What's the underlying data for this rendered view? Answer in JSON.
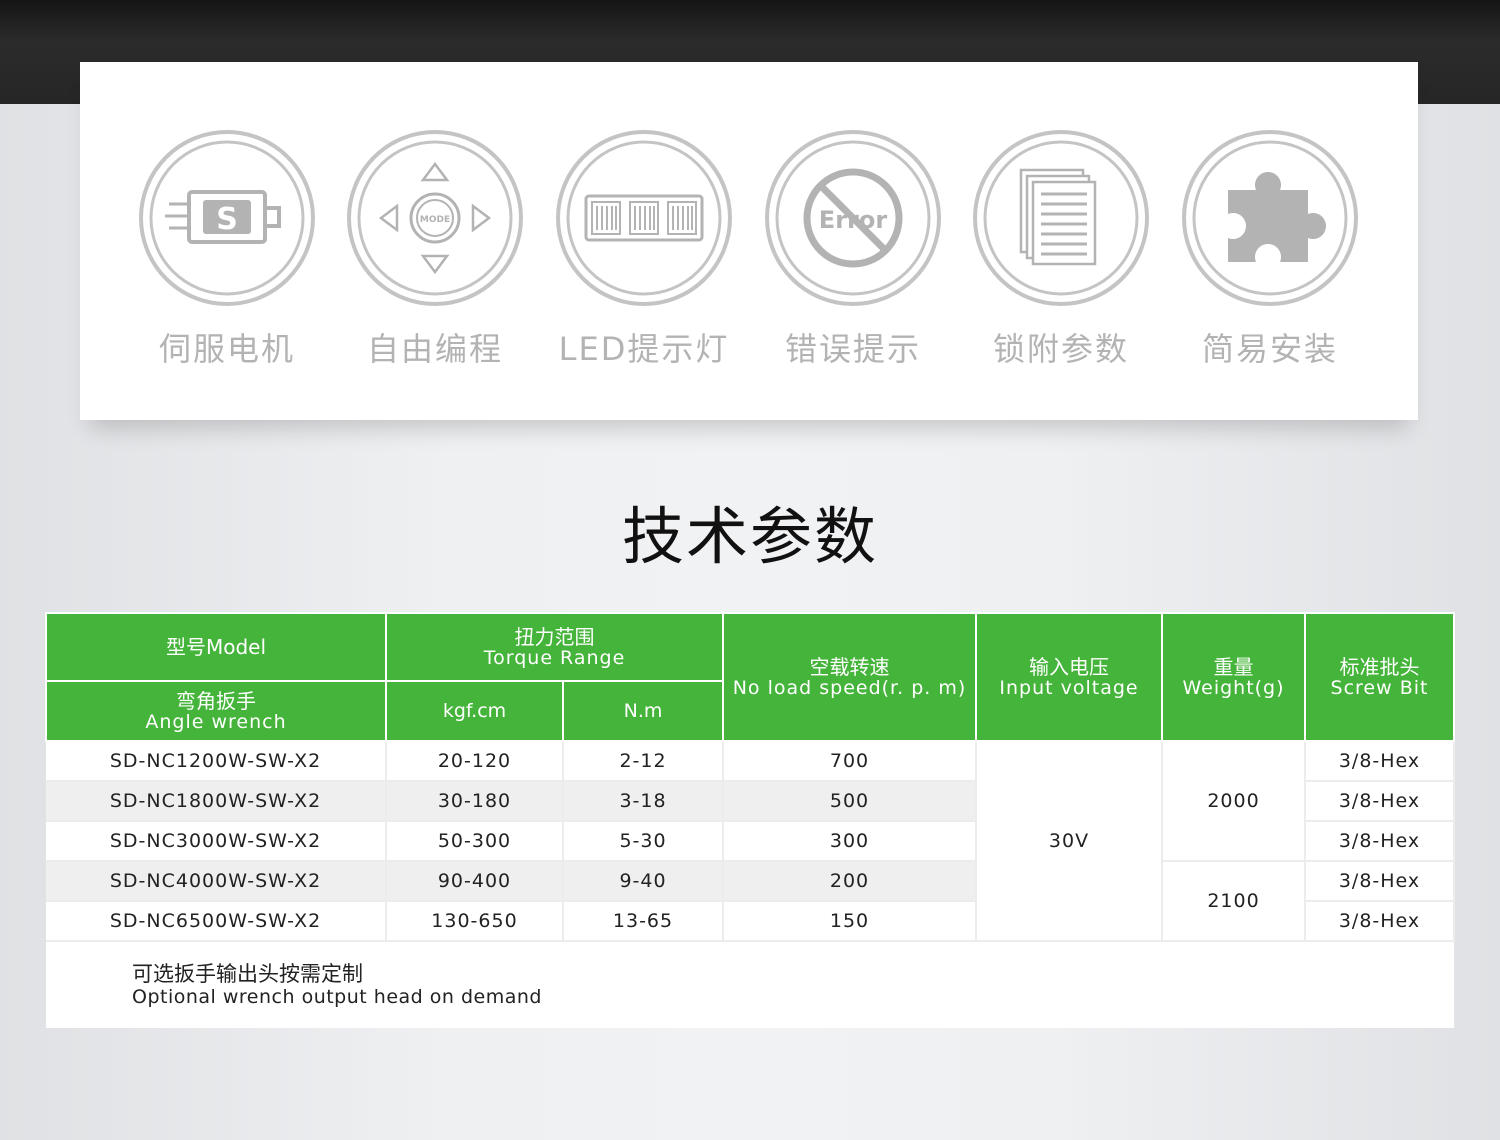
{
  "features": [
    {
      "icon": "servo-motor-icon",
      "label": "伺服电机"
    },
    {
      "icon": "mode-dpad-icon",
      "label": "自由编程"
    },
    {
      "icon": "led-display-icon",
      "label": "LED提示灯"
    },
    {
      "icon": "error-prohibit-icon",
      "label": "错误提示"
    },
    {
      "icon": "document-stack-icon",
      "label": "锁附参数"
    },
    {
      "icon": "puzzle-piece-icon",
      "label": "简易安装"
    }
  ],
  "icon_text": {
    "motor_letter": "S",
    "mode_label": "MODE",
    "error_text": "Error"
  },
  "section_title": "技术参数",
  "table": {
    "headers": {
      "model_cn": "型号Model",
      "angle_cn": "弯角扳手",
      "angle_en": "Angle wrench",
      "torque_cn": "扭力范围",
      "torque_en": "Torque Range",
      "unit_kgf": "kgf.cm",
      "unit_nm": "N.m",
      "speed_cn": "空载转速",
      "speed_en": "No load speed(r. p. m)",
      "voltage_cn": "输入电压",
      "voltage_en": "Input voltage",
      "weight_cn": "重量",
      "weight_en": "Weight(g)",
      "bit_cn": "标准批头",
      "bit_en": "Screw Bit"
    },
    "rows": [
      {
        "model": "SD-NC1200W-SW-X2",
        "kgf": "20-120",
        "nm": "2-12",
        "speed": "700",
        "bit": "3/8-Hex"
      },
      {
        "model": "SD-NC1800W-SW-X2",
        "kgf": "30-180",
        "nm": "3-18",
        "speed": "500",
        "bit": "3/8-Hex"
      },
      {
        "model": "SD-NC3000W-SW-X2",
        "kgf": "50-300",
        "nm": "5-30",
        "speed": "300",
        "bit": "3/8-Hex"
      },
      {
        "model": "SD-NC4000W-SW-X2",
        "kgf": "90-400",
        "nm": "9-40",
        "speed": "200",
        "bit": "3/8-Hex"
      },
      {
        "model": "SD-NC6500W-SW-X2",
        "kgf": "130-650",
        "nm": "13-65",
        "speed": "150",
        "bit": "3/8-Hex"
      }
    ],
    "voltage": "30V",
    "weight_a": "2000",
    "weight_b": "2100",
    "note_cn": "可选扳手输出头按需定制",
    "note_en": "Optional wrench output head on demand"
  },
  "colors": {
    "header_green": "#45b43a",
    "icon_gray": "#b3b3b3",
    "top_bar": "#222222"
  }
}
